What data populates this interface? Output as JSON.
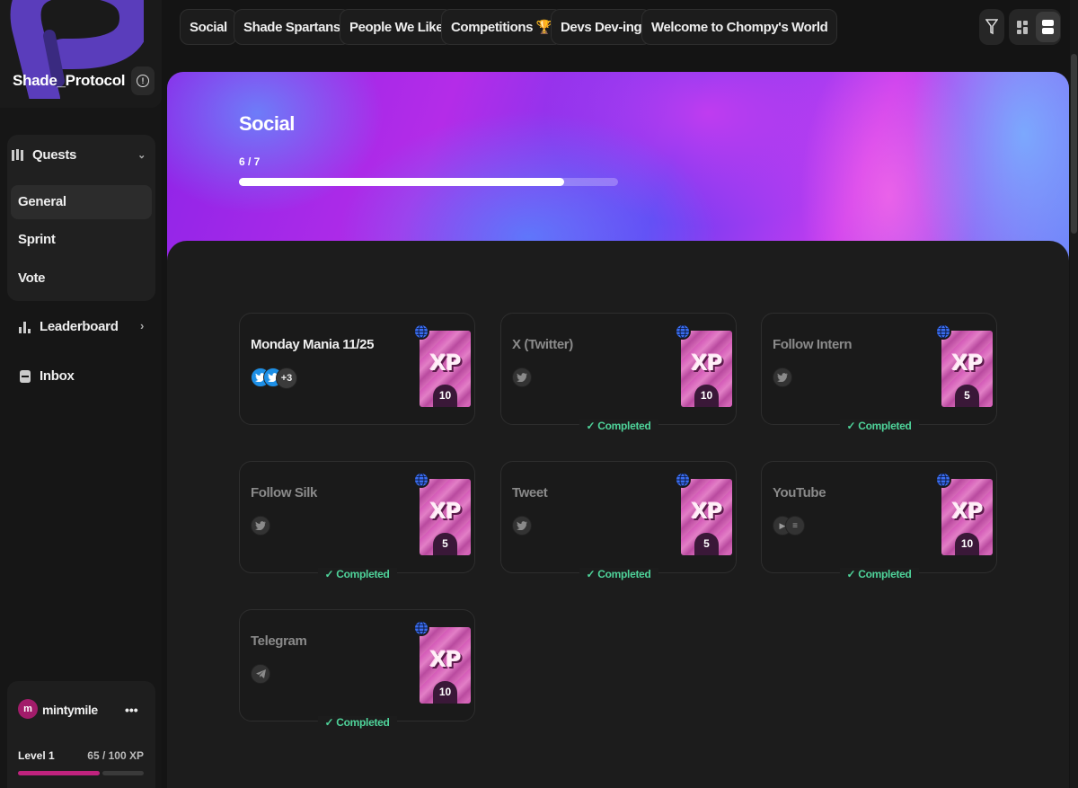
{
  "brand": {
    "name": "Shade_Protocol",
    "info_glyph": "!"
  },
  "sidebar": {
    "quests_label": "Quests",
    "quest_items": [
      {
        "label": "General",
        "active": true
      },
      {
        "label": "Sprint",
        "active": false
      },
      {
        "label": "Vote",
        "active": false
      }
    ],
    "leaderboard_label": "Leaderboard",
    "inbox_label": "Inbox"
  },
  "user": {
    "avatar_initial": "m",
    "name": "mintymile",
    "menu_glyph": "•••",
    "level_label": "Level 1",
    "xp_label": "65 / 100 XP",
    "xp_progress": 0.65,
    "accent_color": "#c0237e"
  },
  "tabs": [
    {
      "label": "Social"
    },
    {
      "label": "Shade Spartans"
    },
    {
      "label": "People We Like"
    },
    {
      "label": "Competitions 🏆"
    },
    {
      "label": "Devs Dev-ing"
    },
    {
      "label": "Welcome to Chompy's World"
    }
  ],
  "toolbar": {
    "icons": [
      "filter-icon",
      "grid-view-icon",
      "list-view-icon"
    ]
  },
  "hero": {
    "title": "Social",
    "count_label": "6 / 7",
    "progress": 0.857
  },
  "quests": [
    {
      "title": "Monday Mania 11/25",
      "xp": "10",
      "completed": false,
      "icons": [
        "twitter",
        "twitter"
      ],
      "extra": "+3"
    },
    {
      "title": "X (Twitter)",
      "xp": "10",
      "completed": true,
      "icons": [
        "twitter"
      ]
    },
    {
      "title": "Follow Intern",
      "xp": "5",
      "completed": true,
      "icons": [
        "twitter"
      ]
    },
    {
      "title": "Follow Silk",
      "xp": "5",
      "completed": true,
      "icons": [
        "twitter"
      ]
    },
    {
      "title": "Tweet",
      "xp": "5",
      "completed": true,
      "icons": [
        "twitter"
      ]
    },
    {
      "title": "YouTube",
      "xp": "10",
      "completed": true,
      "icons": [
        "youtube",
        "list"
      ]
    },
    {
      "title": "Telegram",
      "xp": "10",
      "completed": true,
      "icons": [
        "telegram"
      ]
    }
  ],
  "labels": {
    "completed": "✓ Completed",
    "xp_word": "XP"
  },
  "colors": {
    "completed": "#4fd39a",
    "hero_primary": "#a32cec"
  }
}
